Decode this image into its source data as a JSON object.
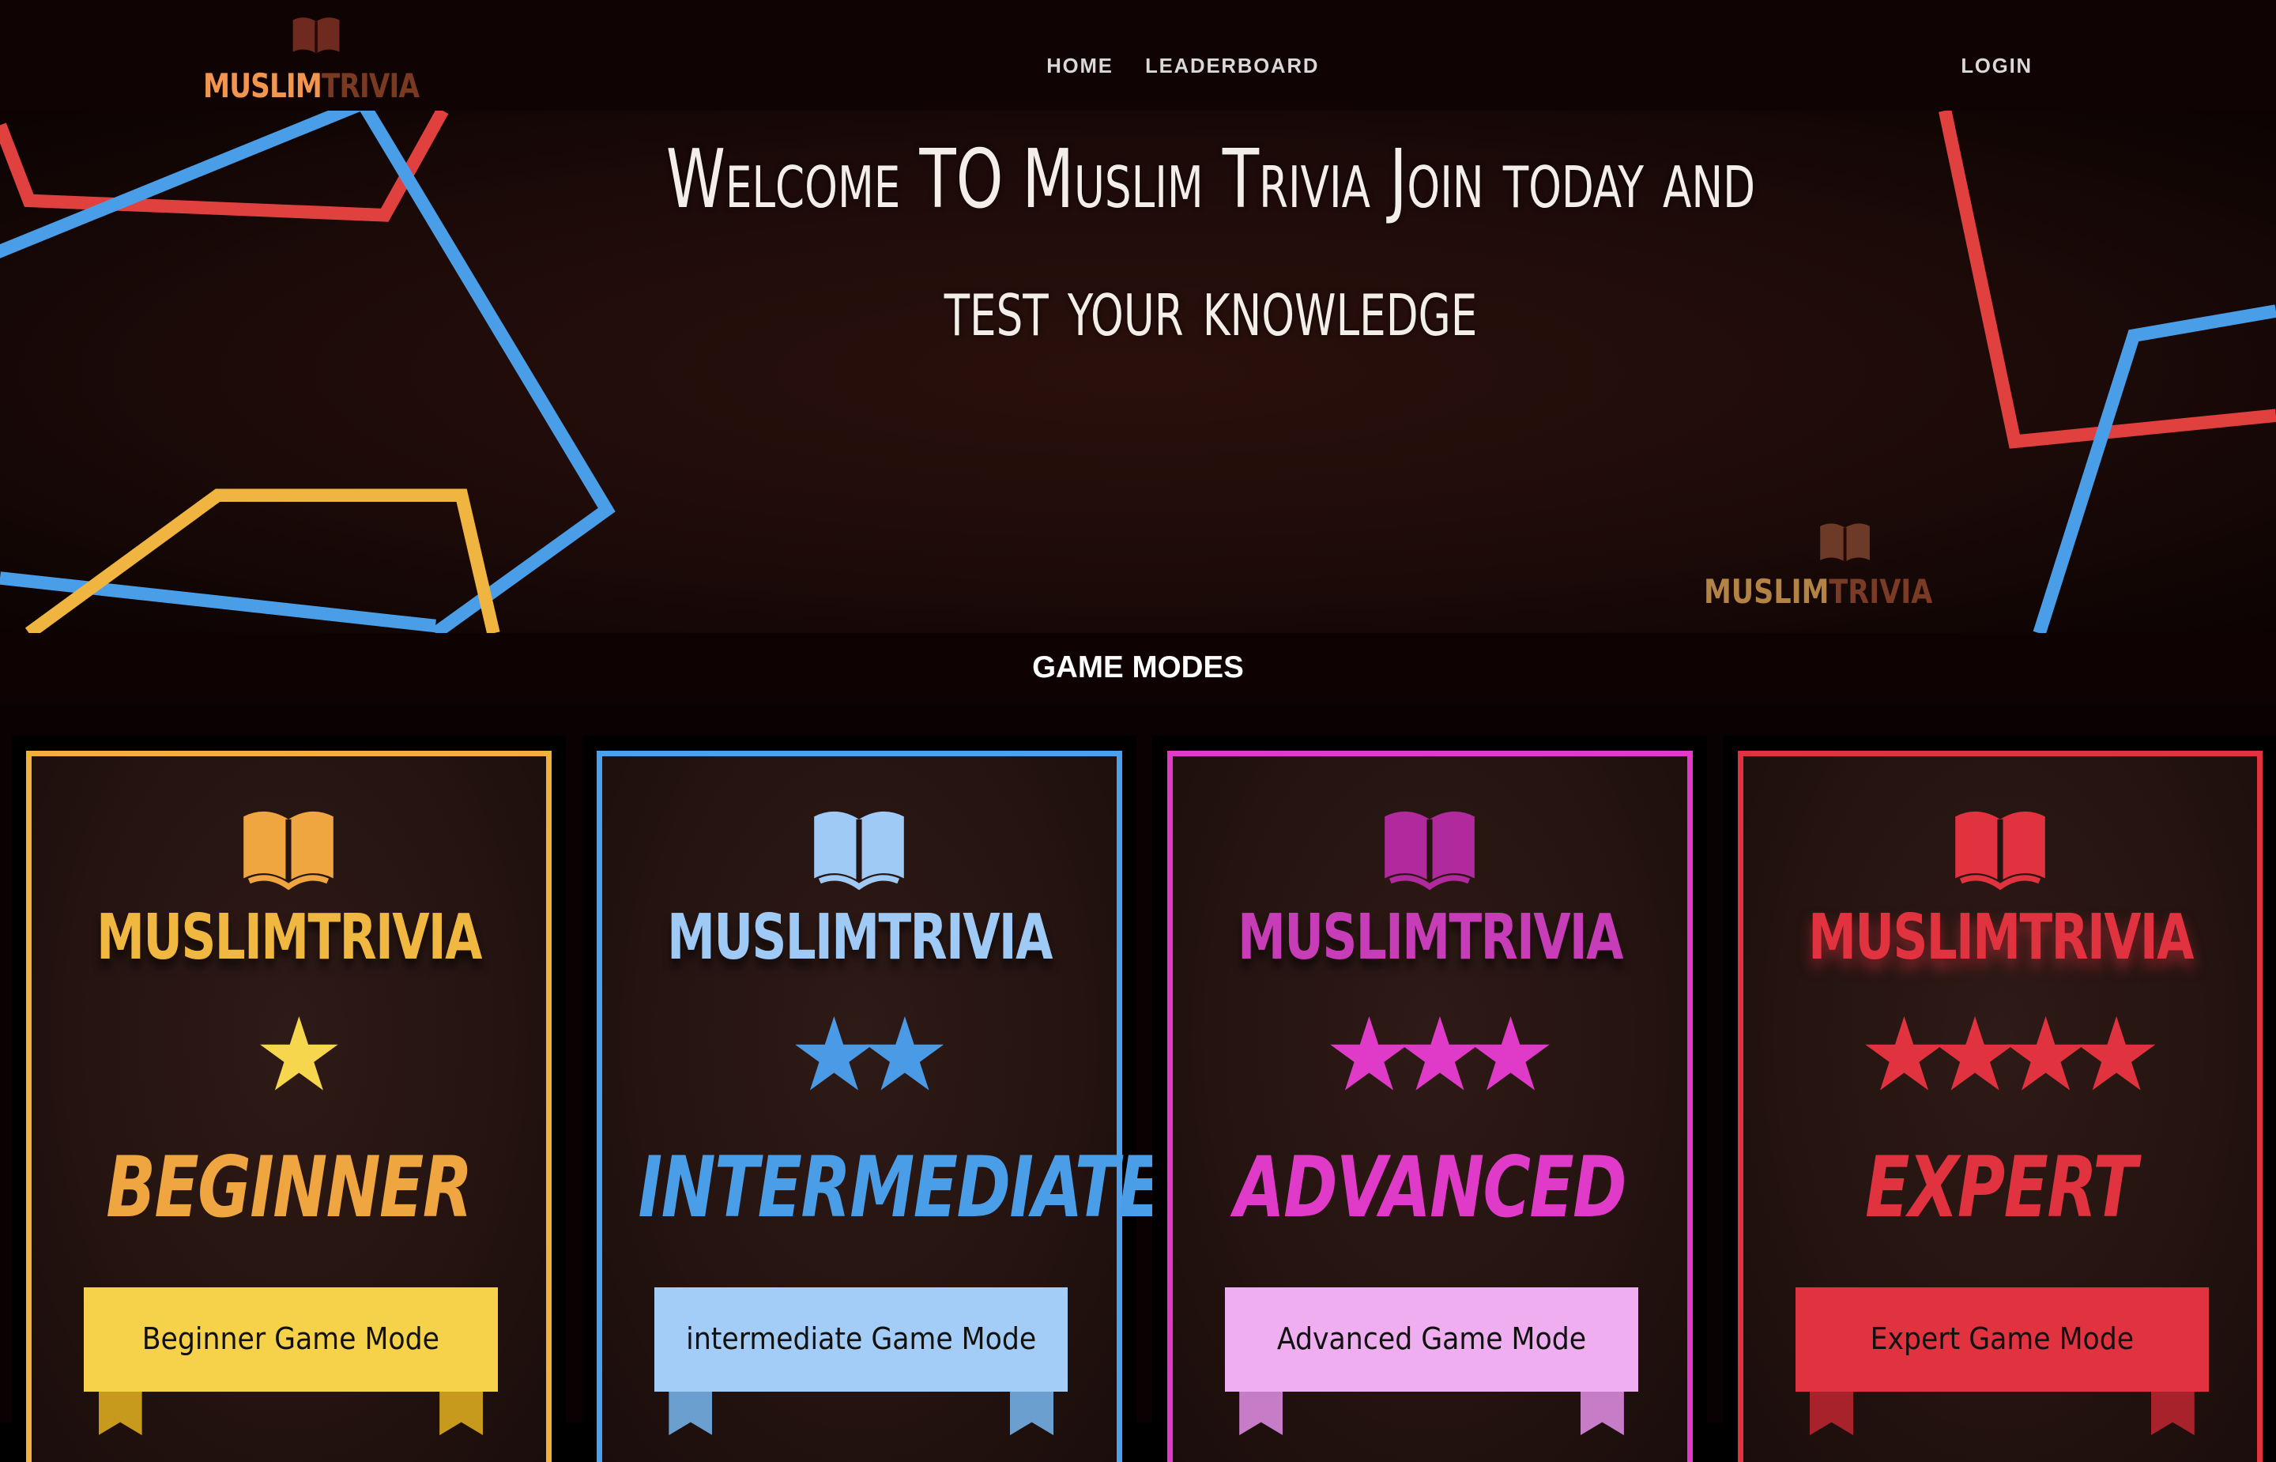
{
  "nav": {
    "logo_part1": "MUSLIM",
    "logo_part2": "TRIVIA",
    "links": [
      "HOME",
      "LEADERBOARD"
    ],
    "login": "LOGIN"
  },
  "hero": {
    "title": "Welcome TO Muslim Trivia Join today and test your knowledge",
    "logo_part1": "MUSLIM",
    "logo_part2": "TRIVIA"
  },
  "section": {
    "title": "GAME MODES"
  },
  "cards": [
    {
      "brand": "MUSLIMTRIVIA",
      "stars": "★",
      "level": "BEGINNER",
      "button": "Beginner Game Mode",
      "color": "#f0a640",
      "star_color": "#f5d64c",
      "ribbon_color": "#f6d24a",
      "ribbon_dark": "#c79a1e"
    },
    {
      "brand": "MUSLIMTRIVIA",
      "stars": "★★",
      "level": "INTERMEDIATE",
      "button": "intermediate Game Mode",
      "color": "#4aa2ef",
      "star_color": "#4a9ae6",
      "ribbon_color": "#a3cdf7",
      "ribbon_dark": "#6b9fd0",
      "brand_color": "#9fcaf6"
    },
    {
      "brand": "MUSLIMTRIVIA",
      "stars": "★★★",
      "level": "ADVANCED",
      "button": "Advanced Game Mode",
      "color": "#e03bc8",
      "star_color": "#e03bc8",
      "ribbon_color": "#efaef0",
      "ribbon_dark": "#c77cc8",
      "brand_color": "#c73db8"
    },
    {
      "brand": "MUSLIMTRIVIA",
      "stars": "★★★★",
      "level": "EXPERT",
      "button": "Expert Game Mode",
      "color": "#e0323f",
      "star_color": "#e0323f",
      "ribbon_color": "#e0323f",
      "ribbon_dark": "#a8222c"
    }
  ]
}
